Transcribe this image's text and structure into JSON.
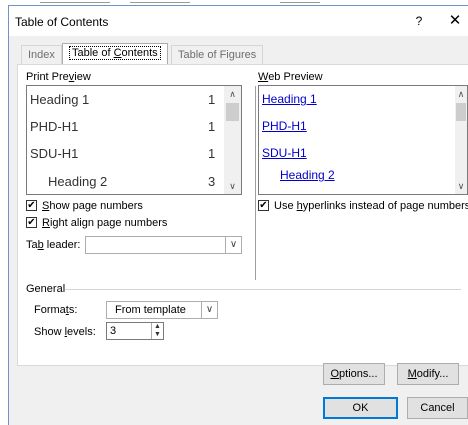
{
  "window": {
    "title": "Table of Contents",
    "help_glyph": "?",
    "close_glyph": "✕"
  },
  "tabs": [
    {
      "label": "Index"
    },
    {
      "label_pre": "Table of ",
      "label_key": "C",
      "label_post": "ontents"
    },
    {
      "label": "Table of Figures"
    }
  ],
  "print_preview": {
    "label_pre": "Print Pre",
    "label_key": "v",
    "label_post": "iew",
    "rows": [
      {
        "text": "Heading 1",
        "page": "1"
      },
      {
        "text": "PHD-H1",
        "page": "1"
      },
      {
        "text": "SDU-H1",
        "page": "1"
      },
      {
        "text": "Heading 2",
        "page": "3"
      }
    ]
  },
  "web_preview": {
    "label_pre": "",
    "label_key": "W",
    "label_post": "eb Preview",
    "links": [
      "Heading 1",
      "PHD-H1",
      "SDU-H1",
      "Heading 2"
    ]
  },
  "options": {
    "show_page_numbers": {
      "pre": "",
      "key": "S",
      "post": "how page numbers",
      "checked": "✔"
    },
    "right_align": {
      "pre": "",
      "key": "R",
      "post": "ight align page numbers",
      "checked": "✔"
    },
    "use_hyperlinks": {
      "pre": "Use ",
      "key": "h",
      "post": "yperlinks instead of page numbers",
      "checked": "✔"
    },
    "tab_leader": {
      "pre": "Ta",
      "key": "b",
      "post": " leader:",
      "value": ""
    }
  },
  "general": {
    "title": "General",
    "formats": {
      "pre": "Forma",
      "key": "t",
      "post": "s:",
      "value": "From template"
    },
    "show_levels": {
      "pre": "Show ",
      "key": "l",
      "post": "evels:",
      "value": "3"
    }
  },
  "buttons": {
    "options": {
      "pre": "",
      "key": "O",
      "post": "ptions..."
    },
    "modify": {
      "pre": "",
      "key": "M",
      "post": "odify..."
    },
    "ok": {
      "label": "OK"
    },
    "cancel": {
      "label": "Cancel"
    }
  },
  "colors": {
    "accent": "#0078d7",
    "link": "#0000cc",
    "frame": "#6f93c5"
  },
  "icons": {
    "dropdown": "∨",
    "scroll_up": "∧",
    "scroll_down": "∨",
    "spin_up": "▲",
    "spin_down": "▼"
  }
}
